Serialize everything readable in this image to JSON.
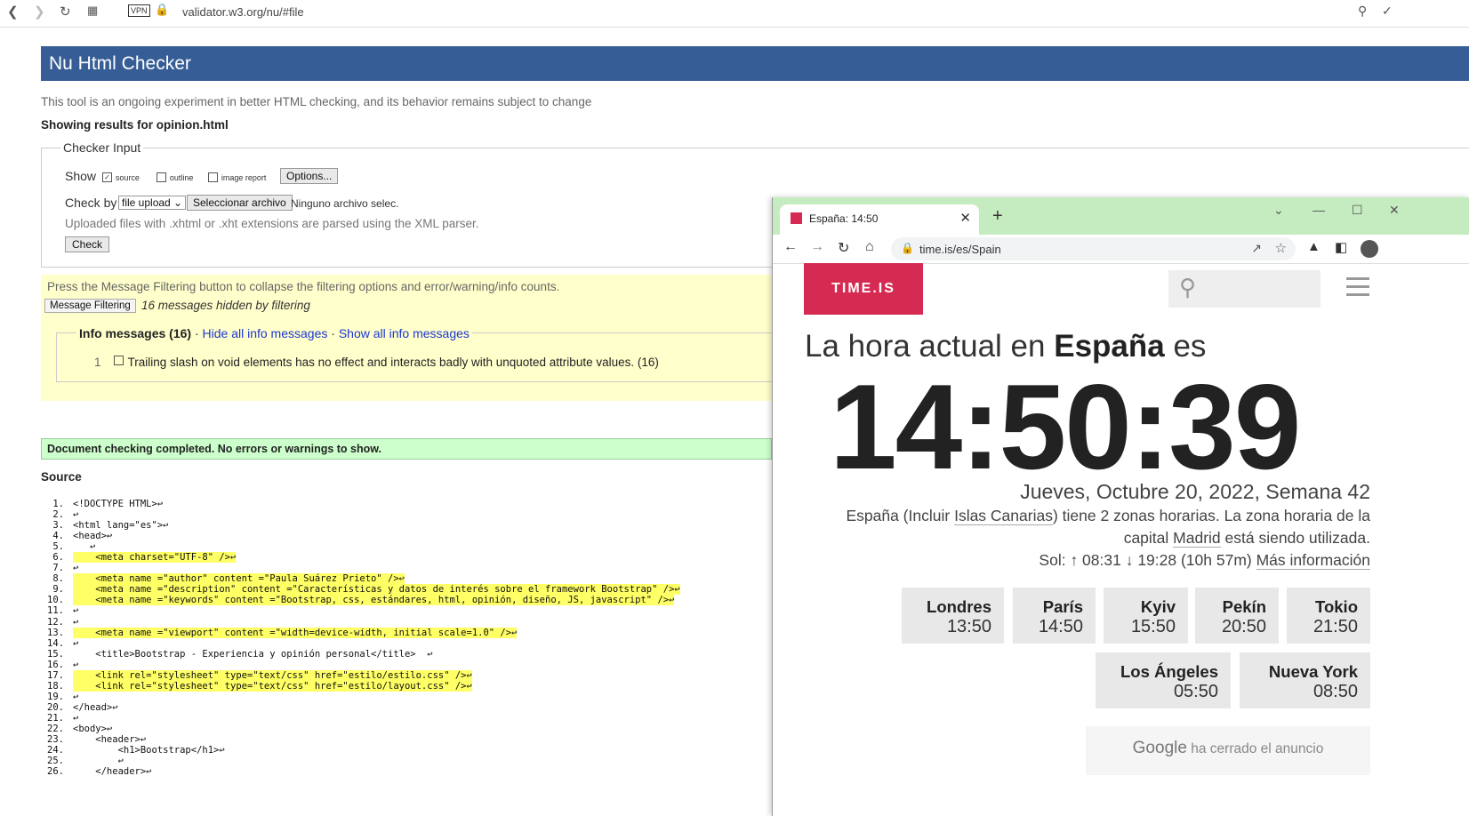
{
  "browser1": {
    "url": "validator.w3.org/nu/#file",
    "vpn": "VPN"
  },
  "validator": {
    "title": "Nu Html Checker",
    "intro": "This tool is an ongoing experiment in better HTML checking, and its behavior remains subject to change",
    "showing": "Showing results for opinion.html",
    "checker_input": "Checker Input",
    "show_label": "Show",
    "show_options": [
      "source",
      "outline",
      "image report"
    ],
    "options_btn": "Options...",
    "check_by": "Check by",
    "check_by_value": "file upload",
    "select_file_btn": "Seleccionar archivo",
    "no_file": "Ninguno archivo selec.",
    "xml_note": "Uploaded files with .xhtml or .xht extensions are parsed using the XML parser.",
    "check_btn": "Check",
    "filter_note": "Press the Message Filtering button to collapse the filtering options and error/warning/info counts.",
    "message_filtering_btn": "Message Filtering",
    "hidden_msgs": "16 messages hidden by filtering",
    "info_title": "Info messages (16)",
    "hide_info": "Hide all info messages",
    "show_info": "Show all info messages",
    "info_num": "1",
    "info_msg": "Trailing slash on void elements has no effect and interacts badly with unquoted attribute values. (16)",
    "completed": "Document checking completed. No errors or warnings to show.",
    "source_heading": "Source",
    "source_lines": [
      {
        "n": "1.",
        "t": "<!DOCTYPE HTML>↩",
        "hl": false
      },
      {
        "n": "2.",
        "t": "↩",
        "hl": false
      },
      {
        "n": "3.",
        "t": "<html lang=\"es\">↩",
        "hl": false
      },
      {
        "n": "4.",
        "t": "<head>↩",
        "hl": false
      },
      {
        "n": "5.",
        "t": "   ↩",
        "hl": false
      },
      {
        "n": "6.",
        "t": "    <meta charset=\"UTF-8\" />↩",
        "hl": true
      },
      {
        "n": "7.",
        "t": "↩",
        "hl": false
      },
      {
        "n": "8.",
        "t": "    <meta name =\"author\" content =\"Paula Suárez Prieto\" />↩",
        "hl": true
      },
      {
        "n": "9.",
        "t": "    <meta name =\"description\" content =\"Características y datos de interés sobre el framework Bootstrap\" />↩",
        "hl": true
      },
      {
        "n": "10.",
        "t": "    <meta name =\"keywords\" content =\"Bootstrap, css, estándares, html, opinión, diseño, JS, javascript\" />↩",
        "hl": true
      },
      {
        "n": "11.",
        "t": "↩",
        "hl": false
      },
      {
        "n": "12.",
        "t": "↩",
        "hl": false
      },
      {
        "n": "13.",
        "t": "    <meta name =\"viewport\" content =\"width=device-width, initial scale=1.0\" />↩",
        "hl": true
      },
      {
        "n": "14.",
        "t": "↩",
        "hl": false
      },
      {
        "n": "15.",
        "t": "    <title>Bootstrap - Experiencia y opinión personal</title>  ↩",
        "hl": false
      },
      {
        "n": "16.",
        "t": "↩",
        "hl": false
      },
      {
        "n": "17.",
        "t": "    <link rel=\"stylesheet\" type=\"text/css\" href=\"estilo/estilo.css\" />↩",
        "hl": true
      },
      {
        "n": "18.",
        "t": "    <link rel=\"stylesheet\" type=\"text/css\" href=\"estilo/layout.css\" />↩",
        "hl": true
      },
      {
        "n": "19.",
        "t": "↩",
        "hl": false
      },
      {
        "n": "20.",
        "t": "</head>↩",
        "hl": false
      },
      {
        "n": "21.",
        "t": "↩",
        "hl": false
      },
      {
        "n": "22.",
        "t": "<body>↩",
        "hl": false
      },
      {
        "n": "23.",
        "t": "    <header>↩",
        "hl": false
      },
      {
        "n": "24.",
        "t": "        <h1>Bootstrap</h1>↩",
        "hl": false
      },
      {
        "n": "25.",
        "t": "        ↩",
        "hl": false
      },
      {
        "n": "26.",
        "t": "    </header>↩",
        "hl": false
      }
    ]
  },
  "timewin": {
    "tab_title": "España: 14:50",
    "url": "time.is/es/Spain",
    "logo": "TIME.IS",
    "heading_pre": "La hora actual en",
    "heading_country": "España",
    "heading_post": "es",
    "time": "14:50:39",
    "date": "Jueves, Octubre 20, 2022, Semana 42",
    "zone_1": "España (Incluir",
    "zone_link1": "Islas Canarias",
    "zone_2": ") tiene 2 zonas horarias. La zona horaria de la",
    "zone_3": "capital",
    "zone_link2": "Madrid",
    "zone_4": "está siendo utilizada.",
    "sun": "Sol: ↑ 08:31 ↓ 19:28 (10h 57m)",
    "more_info": "Más información",
    "cities": [
      {
        "name": "Londres",
        "time": "13:50"
      },
      {
        "name": "París",
        "time": "14:50"
      },
      {
        "name": "Kyiv",
        "time": "15:50"
      },
      {
        "name": "Pekín",
        "time": "20:50"
      },
      {
        "name": "Tokio",
        "time": "21:50"
      },
      {
        "name": "Los Ángeles",
        "time": "05:50"
      },
      {
        "name": "Nueva York",
        "time": "08:50"
      }
    ],
    "ad_google": "Google",
    "ad_text": "ha cerrado el anuncio"
  }
}
